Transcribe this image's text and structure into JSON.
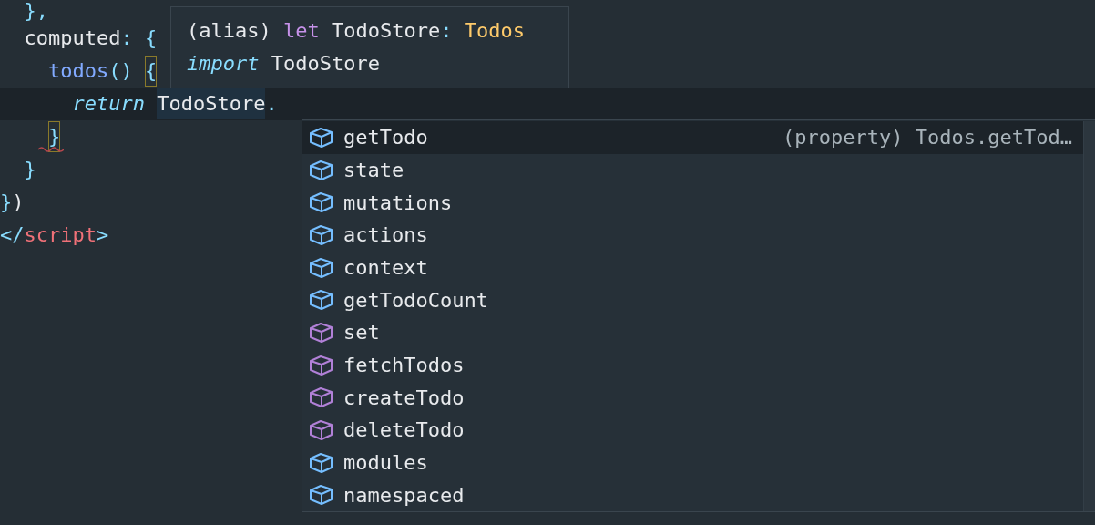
{
  "editor": {
    "lines": [
      {
        "current": false,
        "squiggle": false,
        "tokens": [
          {
            "text": "  },",
            "kind": "punct"
          }
        ]
      },
      {
        "current": false,
        "squiggle": false,
        "tokens": [
          {
            "text": "  computed",
            "kind": "plain"
          },
          {
            "text": ": {",
            "kind": "punct"
          }
        ]
      },
      {
        "current": false,
        "squiggle": false,
        "tokens": [
          {
            "text": "    todos",
            "kind": "method"
          },
          {
            "text": "() ",
            "kind": "punct"
          },
          {
            "text": "{",
            "kind": "match"
          }
        ]
      },
      {
        "current": true,
        "squiggle": false,
        "tokens": [
          {
            "text": "      return ",
            "kind": "keyword"
          },
          {
            "text": "TodoStore",
            "kind": "highlight"
          },
          {
            "text": ".",
            "kind": "punct"
          }
        ]
      },
      {
        "current": false,
        "squiggle": true,
        "tokens": [
          {
            "text": "    }",
            "kind": "match"
          }
        ]
      },
      {
        "current": false,
        "squiggle": false,
        "tokens": [
          {
            "text": "  }",
            "kind": "punct"
          }
        ]
      },
      {
        "current": false,
        "squiggle": false,
        "tokens": [
          {
            "text": "}",
            "kind": "punct"
          },
          {
            "text": ")",
            "kind": "plain"
          }
        ]
      },
      {
        "current": false,
        "squiggle": false,
        "tokens": [
          {
            "text": "</",
            "kind": "punct"
          },
          {
            "text": "script",
            "kind": "tag"
          },
          {
            "text": ">",
            "kind": "punct"
          }
        ]
      }
    ]
  },
  "hover": {
    "lines": [
      [
        {
          "text": "(alias) ",
          "kind": "plain"
        },
        {
          "text": "let",
          "kind": "storage"
        },
        {
          "text": " TodoStore",
          "kind": "plain"
        },
        {
          "text": ":",
          "kind": "punct"
        },
        {
          "text": " Todos",
          "kind": "type"
        }
      ],
      [
        {
          "text": "import",
          "kind": "keyword"
        },
        {
          "text": " TodoStore",
          "kind": "plain"
        }
      ]
    ]
  },
  "suggestions": [
    {
      "label": "getTodo",
      "kind": "property",
      "selected": true,
      "detail": "(property) Todos.getTod…"
    },
    {
      "label": "state",
      "kind": "property",
      "selected": false
    },
    {
      "label": "mutations",
      "kind": "property",
      "selected": false
    },
    {
      "label": "actions",
      "kind": "property",
      "selected": false
    },
    {
      "label": "context",
      "kind": "property",
      "selected": false
    },
    {
      "label": "getTodoCount",
      "kind": "property",
      "selected": false
    },
    {
      "label": "set",
      "kind": "method",
      "selected": false
    },
    {
      "label": "fetchTodos",
      "kind": "method",
      "selected": false
    },
    {
      "label": "createTodo",
      "kind": "method",
      "selected": false
    },
    {
      "label": "deleteTodo",
      "kind": "method",
      "selected": false
    },
    {
      "label": "modules",
      "kind": "property",
      "selected": false
    },
    {
      "label": "namespaced",
      "kind": "property",
      "selected": false
    }
  ]
}
